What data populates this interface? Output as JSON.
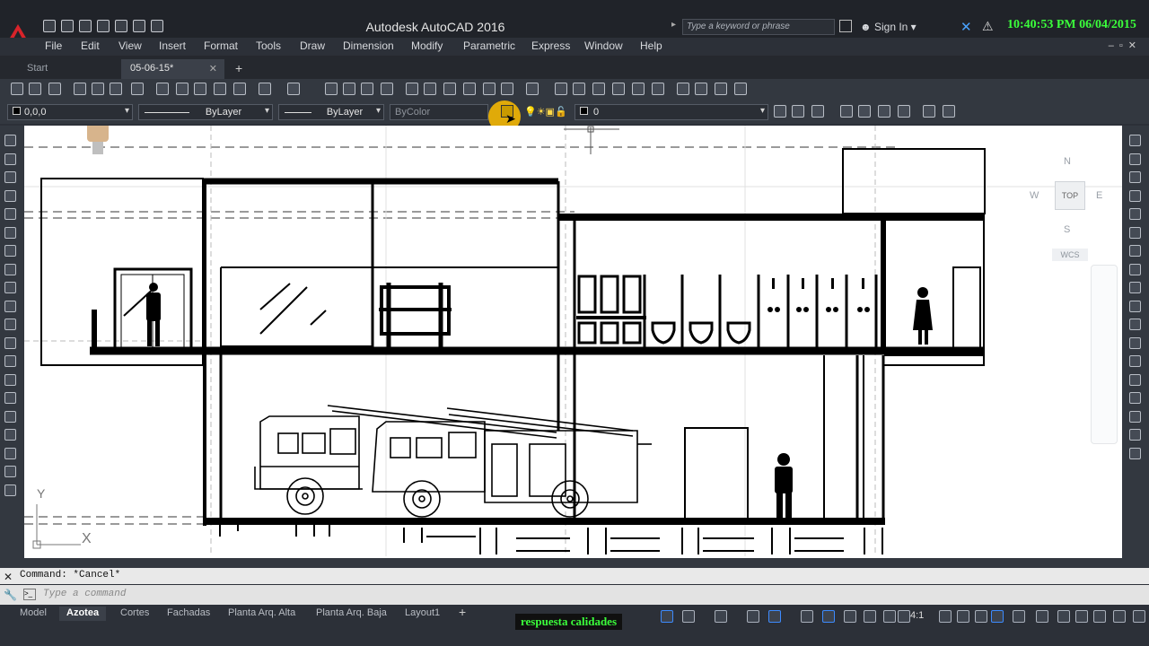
{
  "app": {
    "title": "Autodesk AutoCAD 2016",
    "search_placeholder": "Type a keyword or phrase",
    "sign_in": "Sign In",
    "clock": "10:40:53 PM 06/04/2015"
  },
  "menu": [
    "File",
    "Edit",
    "View",
    "Insert",
    "Format",
    "Tools",
    "Draw",
    "Dimension",
    "Modify",
    "Parametric",
    "Express",
    "Window",
    "Help"
  ],
  "file_tabs": {
    "start": "Start",
    "doc": "05-06-15*"
  },
  "properties": {
    "color": "0,0,0",
    "linetype": "ByLayer",
    "lineweight": "ByLayer",
    "plotstyle": "ByColor",
    "layer": "0"
  },
  "viewcube": {
    "top": "TOP",
    "north": "N",
    "south": "S",
    "west": "W",
    "east": "E",
    "wcs": "WCS"
  },
  "ucs": {
    "x": "X",
    "y": "Y"
  },
  "command": {
    "history": "Command: *Cancel*",
    "placeholder": "Type a command"
  },
  "layout_tabs": [
    "Model",
    "Azotea",
    "Cortes",
    "Fachadas",
    "Planta Arq. Alta",
    "Planta Arq. Baja",
    "Layout1"
  ],
  "active_layout": "Azotea",
  "overlay": "respuesta calidades",
  "status": {
    "scale": "4:1"
  }
}
